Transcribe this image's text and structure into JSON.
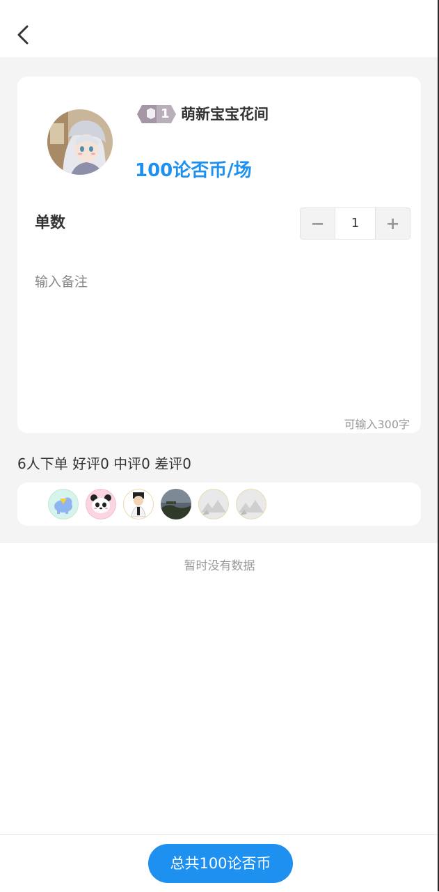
{
  "header": {
    "back_icon": "chevron-left-icon"
  },
  "profile": {
    "level_badge_icon": "cube-hexagon-icon",
    "level": "1",
    "nickname": "萌新宝宝花间",
    "price": "100论否币/场"
  },
  "quantity": {
    "label": "单数",
    "value": "1",
    "minus": "−",
    "plus": "+"
  },
  "note": {
    "placeholder": "输入备注",
    "hint": "可输入300字"
  },
  "reviews": {
    "summary": "6人下单 好评0 中评0 差评0",
    "buyer_avatars": [
      "elephant-avatar",
      "panda-avatar",
      "cartoon-boy-avatar",
      "landscape-avatar",
      "mountain-avatar",
      "mountain-avatar"
    ]
  },
  "empty_state": "暂时没有数据",
  "footer": {
    "submit_label": "总共100论否币"
  },
  "colors": {
    "accent": "#1e90f0",
    "background": "#f4f4f4",
    "card": "#ffffff"
  }
}
